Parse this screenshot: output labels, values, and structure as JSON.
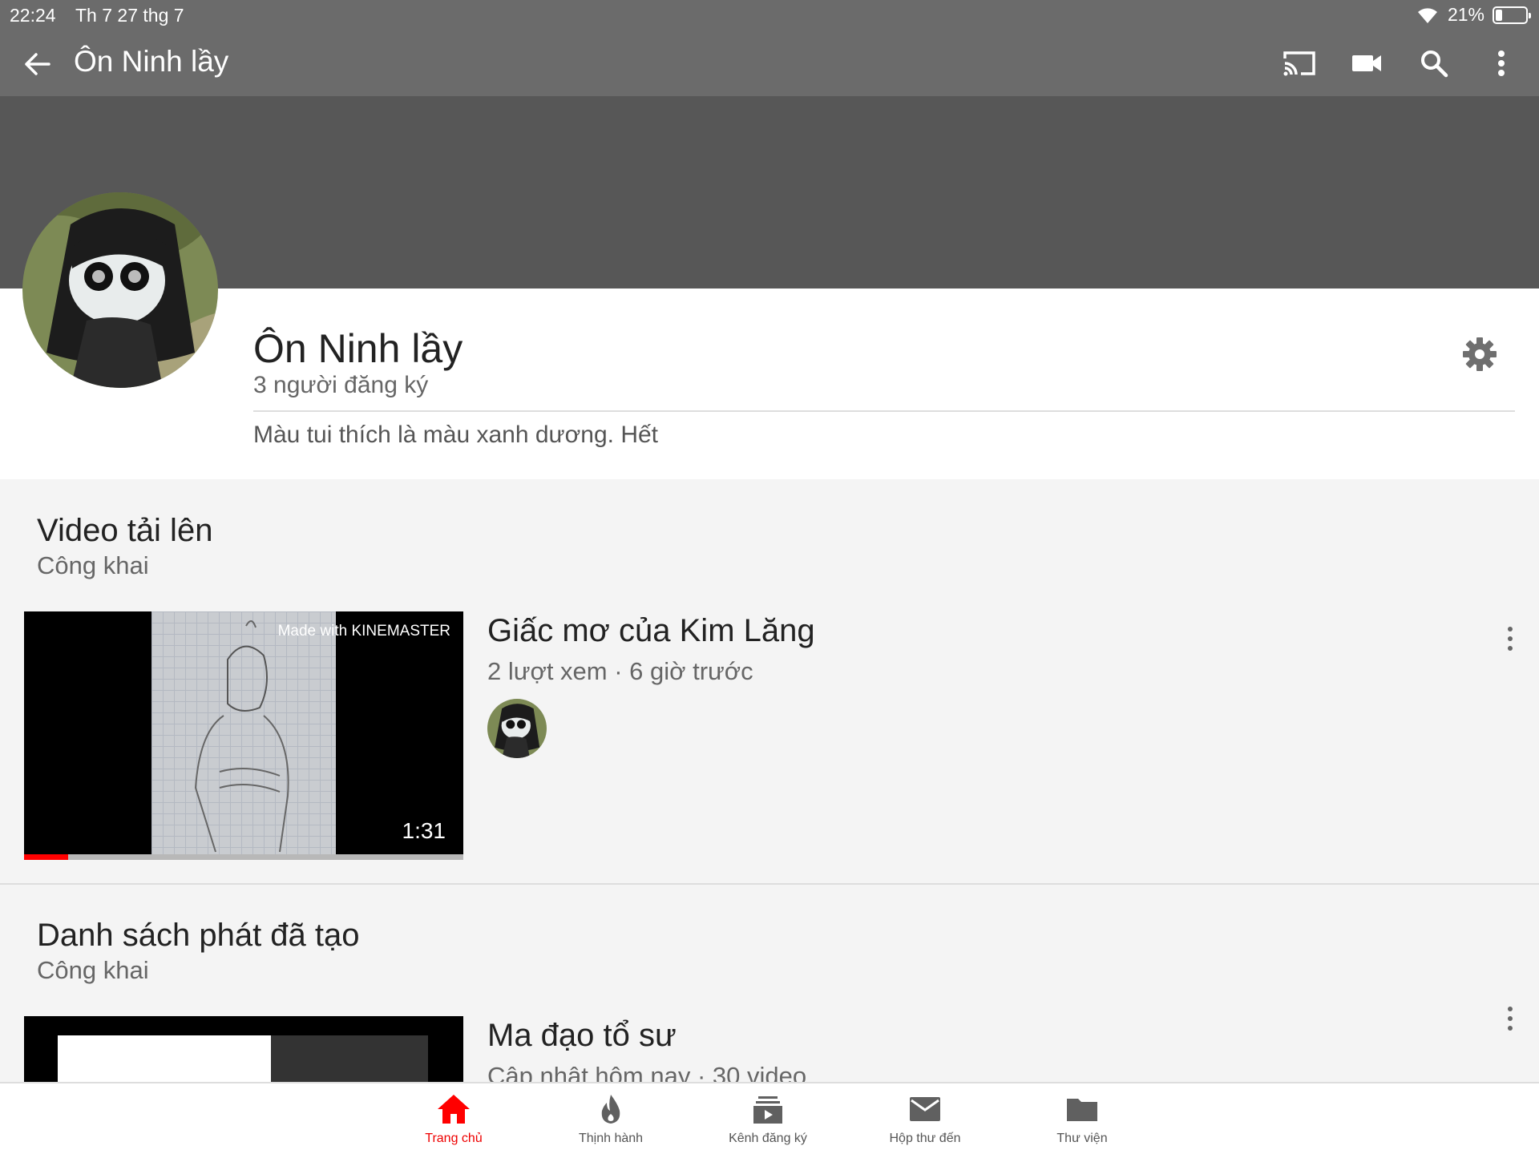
{
  "status_bar": {
    "time": "22:24",
    "date": "Th 7 27 thg 7",
    "battery": "21%",
    "battery_level": 0.21
  },
  "app_bar": {
    "title": "Ôn Ninh lầy"
  },
  "channel": {
    "name": "Ôn Ninh lầy",
    "subscribers": "3 người đăng ký",
    "description": "Màu tui thích là màu xanh dương. Hết"
  },
  "uploads": {
    "title": "Video tải lên",
    "visibility": "Công khai",
    "video": {
      "title": "Giấc mơ của Kim Lăng",
      "meta": "2 lượt xem · 6 giờ trước",
      "duration": "1:31",
      "watermark": "Made with KINEMASTER",
      "progress": 0.1
    }
  },
  "playlists": {
    "title": "Danh sách phát đã tạo",
    "visibility": "Công khai",
    "playlist": {
      "title": "Ma đạo tổ sư",
      "meta": "Cập nhật hôm nay · 30 video"
    }
  },
  "bottom_nav": [
    {
      "label": "Trang chủ",
      "icon": "home-icon",
      "active": true
    },
    {
      "label": "Thịnh hành",
      "icon": "fire-icon",
      "active": false
    },
    {
      "label": "Kênh đăng ký",
      "icon": "subscriptions-icon",
      "active": false
    },
    {
      "label": "Hộp thư đến",
      "icon": "mail-icon",
      "active": false
    },
    {
      "label": "Thư viện",
      "icon": "folder-icon",
      "active": false
    }
  ],
  "colors": {
    "accent": "#ff0000",
    "appbar": "#6b6b6b",
    "banner": "#575757"
  }
}
